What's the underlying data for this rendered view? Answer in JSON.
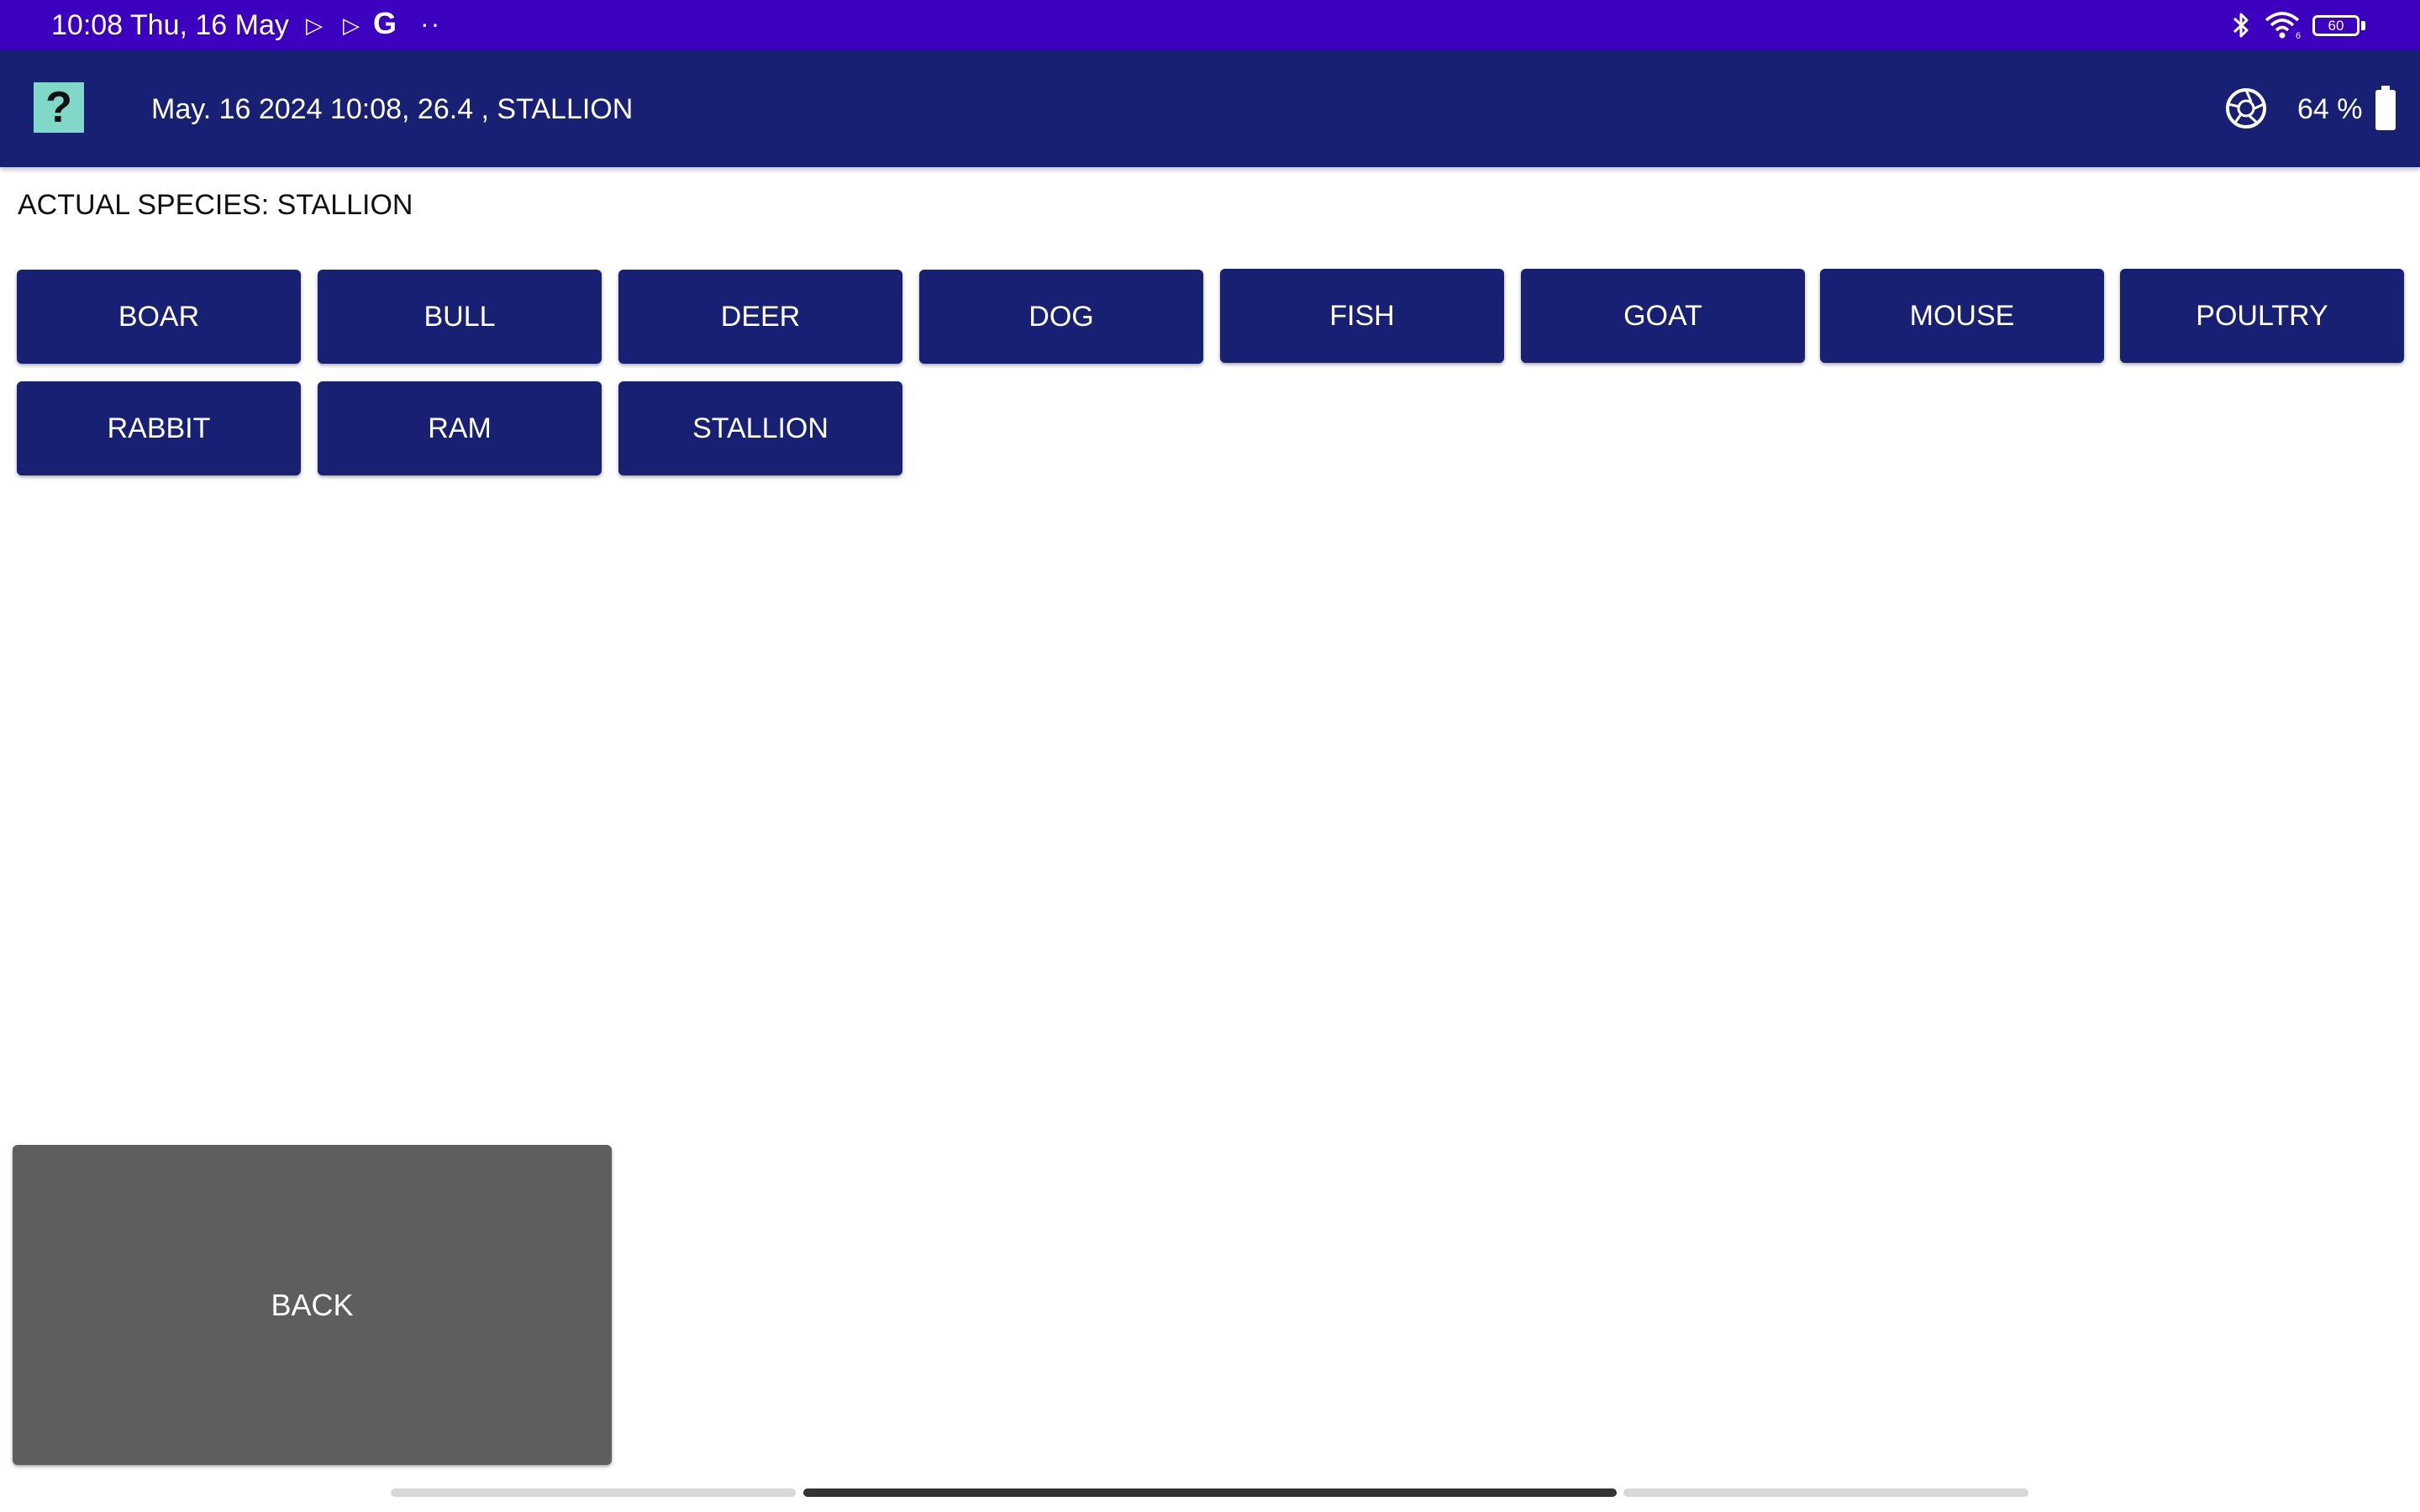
{
  "statusbar": {
    "time": "10:08 Thu, 16 May",
    "g_label": "G",
    "dots": "··",
    "battery_level": "60"
  },
  "appbar": {
    "help_label": "?",
    "title": "May. 16 2024 10:08, 26.4 , STALLION",
    "battery_percent": "64 %"
  },
  "content": {
    "actual_species": "ACTUAL SPECIES: STALLION",
    "species": [
      "BOAR",
      "BULL",
      "DEER",
      "DOG",
      "FISH",
      "GOAT",
      "MOUSE",
      "POULTRY",
      "RABBIT",
      "RAM",
      "STALLION"
    ],
    "back_label": "BACK"
  },
  "colors": {
    "statusbar_bg": "#3c00bf",
    "appbar_bg": "#172073",
    "button_bg": "#172073",
    "help_bg": "#7fd8c8",
    "back_bg": "#5e5e5e"
  }
}
